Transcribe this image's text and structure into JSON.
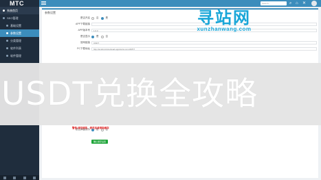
{
  "brand": "MTC",
  "sidebar": {
    "items": [
      {
        "label": "系统首页"
      },
      {
        "label": "SEO管理"
      },
      {
        "label": "基础设置"
      },
      {
        "label": "参数设置"
      },
      {
        "label": "分类管理"
      },
      {
        "label": "软件列表"
      },
      {
        "label": "软件管理"
      }
    ]
  },
  "topbar": {
    "search_placeholder": "Search..."
  },
  "panel": {
    "title": "参数设置",
    "rows": [
      {
        "label": "是否开启",
        "type": "radio",
        "options": [
          "否",
          "是"
        ],
        "selected": 1
      },
      {
        "label": "APP下载链接",
        "type": "text",
        "value": ""
      },
      {
        "label": "APP版本号",
        "type": "text",
        "value": "1.0.0"
      },
      {
        "label": "是否显示",
        "type": "radio",
        "options": [
          "是",
          "否"
        ],
        "selected": 0
      },
      {
        "label": "官网链接",
        "type": "text",
        "value": "USDT"
      },
      {
        "label": "PC下载地址",
        "type": "text",
        "value": "http://android.download.appdoctor.com/APK?"
      }
    ],
    "bottom_row": {
      "label": "是否弹窗提示",
      "warning": "警告:请勿修改，修改后请清除缓存",
      "options": [
        "是",
        "否"
      ],
      "selected": 0
    },
    "submit_label": "确认保存设置"
  },
  "banner_text": "USDT兑换全攻略",
  "watermark": {
    "main": "寻站网",
    "sub": "xunzhanwang.com"
  }
}
